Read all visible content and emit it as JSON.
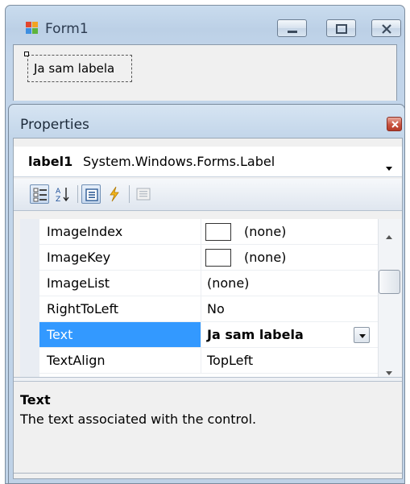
{
  "form": {
    "title": "Form1",
    "label_text": "Ja sam labela"
  },
  "properties_window": {
    "title": "Properties",
    "object": {
      "name": "label1",
      "type": "System.Windows.Forms.Label"
    },
    "toolbar": {
      "buttons": [
        "categorized-icon",
        "alphabetical-icon",
        "properties-icon",
        "events-icon",
        "property-pages-icon"
      ]
    },
    "rows": [
      {
        "name": "ImageIndex",
        "value": "(none)",
        "swatch": true
      },
      {
        "name": "ImageKey",
        "value": "(none)",
        "swatch": true
      },
      {
        "name": "ImageList",
        "value": "(none)"
      },
      {
        "name": "RightToLeft",
        "value": "No"
      },
      {
        "name": "Text",
        "value": "Ja sam labela",
        "selected": true
      },
      {
        "name": "TextAlign",
        "value": "TopLeft"
      }
    ],
    "description": {
      "title": "Text",
      "text": "The text associated with the control."
    }
  },
  "colors": {
    "selection": "#3399ff",
    "chrome": "#c2d5ea",
    "close_button": "#c8523f"
  }
}
